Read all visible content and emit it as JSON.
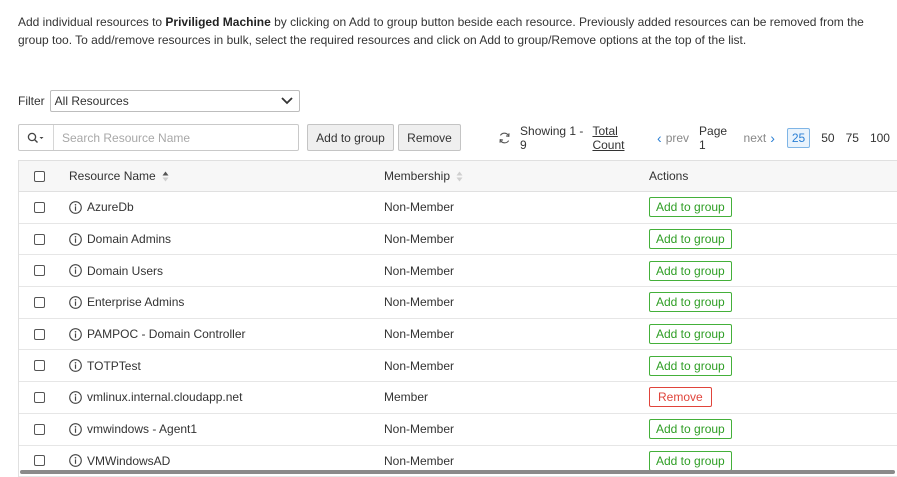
{
  "intro": {
    "part1": "Add individual resources to ",
    "group_name": "Priviliged Machine",
    "part2": " by clicking on Add to group button beside each resource. Previously added resources can be removed from the group too. To add/remove resources in bulk, select the required resources and click on Add to group/Remove options at the top of the list."
  },
  "filter": {
    "label": "Filter",
    "selected": "All Resources"
  },
  "toolbar": {
    "search_placeholder": "Search Resource Name",
    "add_to_group_label": "Add to group",
    "remove_label": "Remove"
  },
  "pager": {
    "showing": "Showing 1 - 9",
    "total_count": "Total Count",
    "prev": "prev",
    "page": "Page 1",
    "next": "next",
    "sizes": [
      "25",
      "50",
      "75",
      "100"
    ],
    "active_size": "25"
  },
  "table": {
    "headers": {
      "name": "Resource Name",
      "membership": "Membership",
      "actions": "Actions"
    },
    "rows": [
      {
        "name": "AzureDb",
        "membership": "Non-Member",
        "action": "Add to group"
      },
      {
        "name": "Domain Admins",
        "membership": "Non-Member",
        "action": "Add to group"
      },
      {
        "name": "Domain Users",
        "membership": "Non-Member",
        "action": "Add to group"
      },
      {
        "name": "Enterprise Admins",
        "membership": "Non-Member",
        "action": "Add to group"
      },
      {
        "name": "PAMPOC - Domain Controller",
        "membership": "Non-Member",
        "action": "Add to group"
      },
      {
        "name": "TOTPTest",
        "membership": "Non-Member",
        "action": "Add to group"
      },
      {
        "name": "vmlinux.internal.cloudapp.net",
        "membership": "Member",
        "action": "Remove"
      },
      {
        "name": "vmwindows - Agent1",
        "membership": "Non-Member",
        "action": "Add to group"
      },
      {
        "name": "VMWindowsAD",
        "membership": "Non-Member",
        "action": "Add to group"
      }
    ]
  },
  "colors": {
    "add_green": "#2e9e24",
    "remove_red": "#e0443b",
    "active_blue": "#2a7fd4"
  }
}
